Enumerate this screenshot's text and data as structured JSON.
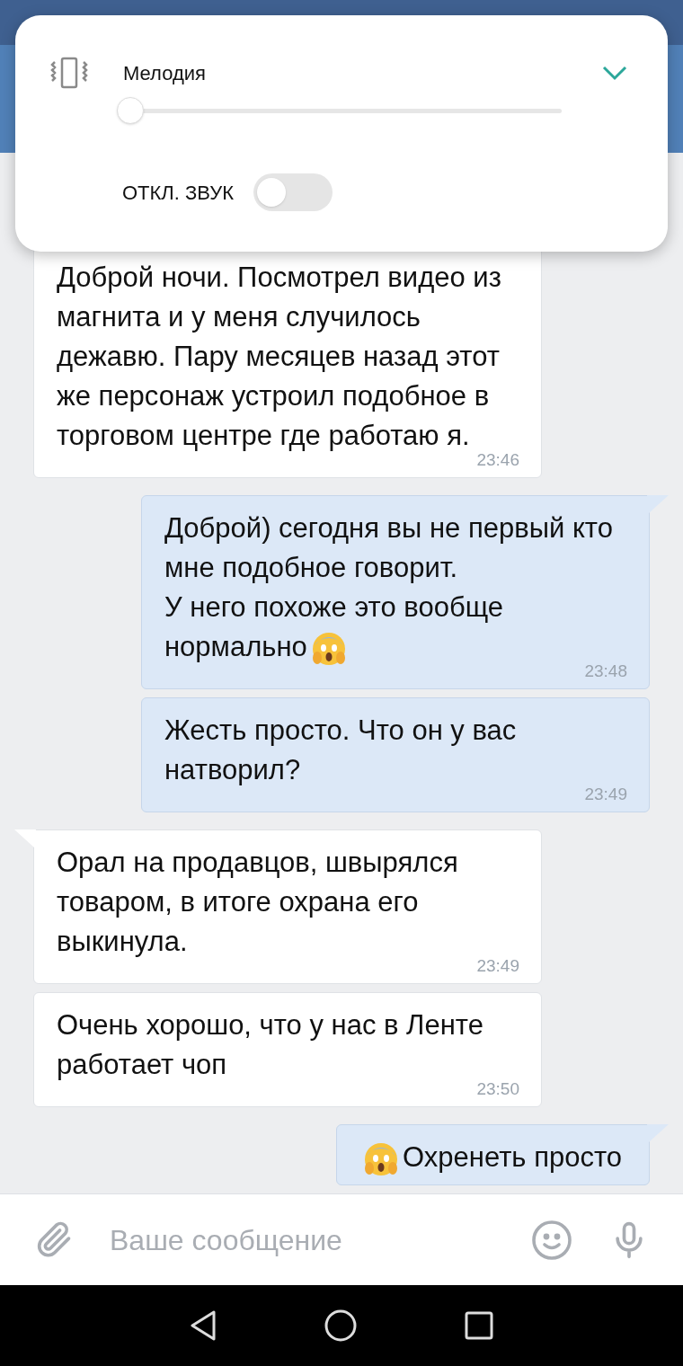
{
  "volume_popup": {
    "title": "Мелодия",
    "expanded": false,
    "slider": {
      "level": 0
    },
    "mute": {
      "label": "ОТКЛ. ЗВУК",
      "on": false
    }
  },
  "messages": [
    {
      "outgoing": false,
      "tail": false,
      "text": "Доброй ночи. Посмотрел видео из магнита и у меня случилось дежавю. Пару месяцев назад этот же персонаж устроил подобное в торговом центре где работаю я.",
      "time": "23:46"
    },
    {
      "outgoing": true,
      "tail": true,
      "text": "Доброй) сегодня вы не первый кто мне подобное говорит.\nУ него похоже это вообще нормально",
      "emoji_after": true,
      "time": "23:48"
    },
    {
      "outgoing": true,
      "tail": false,
      "text": "Жесть просто. Что он у вас натворил?",
      "time": "23:49"
    },
    {
      "outgoing": false,
      "tail": true,
      "text": "Орал на продавцов, швырялся товаром, в итоге охрана его выкинула.",
      "time": "23:49"
    },
    {
      "outgoing": false,
      "tail": false,
      "text": "Очень хорошо, что у нас в Ленте работает чоп",
      "time": "23:50"
    },
    {
      "outgoing": true,
      "tail": true,
      "text": "Охренеть просто",
      "emoji_before": true
    }
  ],
  "composer": {
    "placeholder": "Ваше сообщение"
  }
}
